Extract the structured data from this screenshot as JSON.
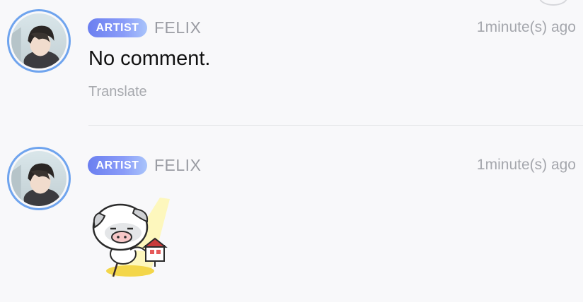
{
  "comments": [
    {
      "badge": "ARTIST",
      "username": "FELIX",
      "timestamp": "1minute(s) ago",
      "text": "No comment.",
      "translate_label": "Translate",
      "avatar_icon": "profile-photo"
    },
    {
      "badge": "ARTIST",
      "username": "FELIX",
      "timestamp": "1minute(s) ago",
      "sticker_icon": "pig-sticker",
      "avatar_icon": "profile-photo"
    }
  ],
  "colors": {
    "avatar_ring": "#6fa4ee",
    "badge_gradient_start": "#6b7ff0",
    "badge_gradient_end": "#a9c4fb",
    "username": "#9a9ca3",
    "background": "#f8f8fa"
  }
}
